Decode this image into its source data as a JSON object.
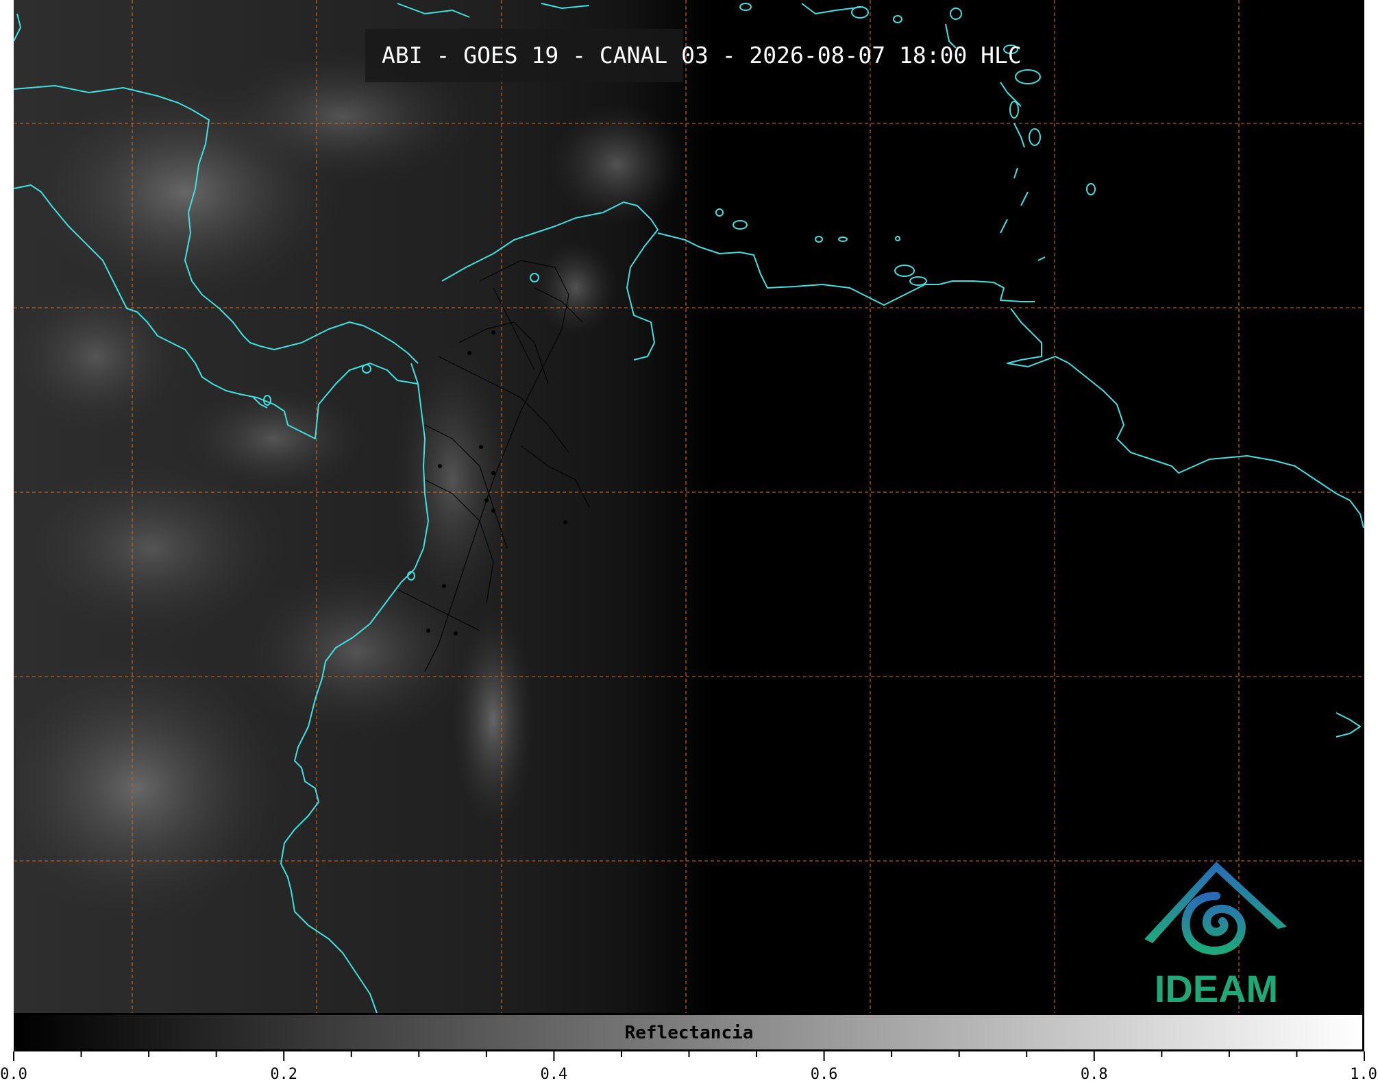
{
  "title": "ABI - GOES 19 - CANAL 03 - 2026-08-07 18:00 HLC",
  "colorbar": {
    "label": "Reflectancia",
    "ticks": [
      "0.0",
      "0.2",
      "0.4",
      "0.6",
      "0.8",
      "1.0"
    ],
    "range": [
      0.0,
      1.0
    ],
    "gradient_start": "#000000",
    "gradient_end": "#ffffff"
  },
  "logo": {
    "text": "IDEAM",
    "color": "#1fa97a"
  },
  "colors": {
    "coastline": "#40e0e0",
    "grid": "#d2691e",
    "borders": "#000000"
  }
}
